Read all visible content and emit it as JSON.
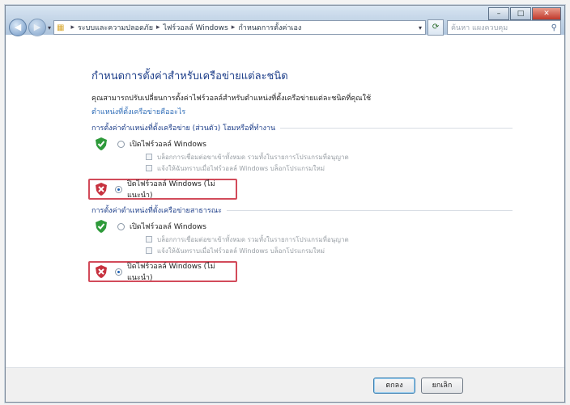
{
  "window": {
    "caption_minimize": "–",
    "caption_maximize": "□",
    "caption_close": "✕"
  },
  "nav": {
    "back_icon": "arrow-left",
    "forward_icon": "arrow-right",
    "breadcrumb": [
      "แผงควบคุม",
      "ระบบและความปลอดภัย",
      "ไฟร์วอลล์ Windows",
      "กำหนดการตั้งค่าเอง"
    ],
    "search_placeholder": "ค้นหา แผงควบคุม"
  },
  "main": {
    "title": "กำหนดการตั้งค่าสำหรับเครือข่ายแต่ละชนิด",
    "description": "คุณสามารถปรับเปลี่ยนการตั้งค่าไฟร์วอลล์สำหรับตำแหน่งที่ตั้งเครือข่ายแต่ละชนิดที่คุณใช้",
    "link": "ตำแหน่งที่ตั้งเครือข่ายคืออะไร",
    "sections": [
      {
        "title": "การตั้งค่าตำแหน่งที่ตั้งเครือข่าย (ส่วนตัว) โฮมหรือที่ทำงาน",
        "on_label": "เปิดไฟร์วอลล์ Windows",
        "block_all_label": "บล็อกการเชื่อมต่อขาเข้าทั้งหมด รวมทั้งในรายการโปรแกรมที่อนุญาต",
        "notify_label": "แจ้งให้ฉันทราบเมื่อไฟร์วอลล์ Windows บล็อกโปรแกรมใหม่",
        "off_label": "ปิดไฟร์วอลล์ Windows (ไม่แนะนำ)"
      },
      {
        "title": "การตั้งค่าตำแหน่งที่ตั้งเครือข่ายสาธารณะ",
        "on_label": "เปิดไฟร์วอลล์ Windows",
        "block_all_label": "บล็อกการเชื่อมต่อขาเข้าทั้งหมด รวมทั้งในรายการโปรแกรมที่อนุญาต",
        "notify_label": "แจ้งให้ฉันทราบเมื่อไฟร์วอลล์ Windows บล็อกโปรแกรมใหม่",
        "off_label": "ปิดไฟร์วอลล์ Windows (ไม่แนะนำ)"
      }
    ]
  },
  "footer": {
    "ok_label": "ตกลง",
    "cancel_label": "ยกเลิก"
  },
  "colors": {
    "highlight": "#d24b5a",
    "title_blue": "#1e3f8a",
    "link_blue": "#2f6db8"
  }
}
